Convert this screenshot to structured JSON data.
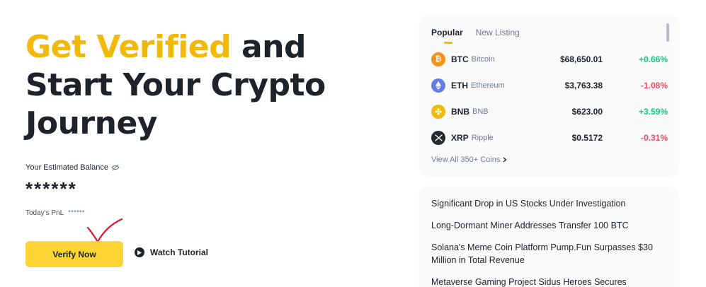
{
  "hero": {
    "title_accent": "Get Verified",
    "title_rest_1": " and",
    "title_line_2": "Start Your Crypto",
    "title_line_3": "Journey"
  },
  "balance": {
    "label": "Your Estimated Balance",
    "value": "******",
    "pnl_label": "Today's PnL",
    "pnl_value": "******"
  },
  "actions": {
    "verify_label": "Verify Now",
    "tutorial_label": "Watch Tutorial"
  },
  "market": {
    "tabs": [
      "Popular",
      "New Listing"
    ],
    "coins": [
      {
        "symbol": "BTC",
        "name": "Bitcoin",
        "price": "$68,650.01",
        "change": "+0.66%",
        "direction": "up",
        "icon": "bitcoin-icon",
        "color": "#f7931a"
      },
      {
        "symbol": "ETH",
        "name": "Ethereum",
        "price": "$3,763.38",
        "change": "-1.08%",
        "direction": "down",
        "icon": "ethereum-icon",
        "color": "#627eea"
      },
      {
        "symbol": "BNB",
        "name": "BNB",
        "price": "$623.00",
        "change": "+3.59%",
        "direction": "up",
        "icon": "bnb-icon",
        "color": "#f0b90b"
      },
      {
        "symbol": "XRP",
        "name": "Ripple",
        "price": "$0.5172",
        "change": "-0.31%",
        "direction": "down",
        "icon": "xrp-icon",
        "color": "#23292f"
      }
    ],
    "view_all": "View All 350+ Coins"
  },
  "news": [
    "Significant Drop in US Stocks Under Investigation",
    "Long-Dormant Miner Addresses Transfer 100 BTC",
    "Solana's Meme Coin Platform Pump.Fun Surpasses $30 Million in Total Revenue",
    "Metaverse Gaming Project Sidus Heroes Secures"
  ],
  "colors": {
    "accent": "#f0b90b",
    "button": "#fcd535",
    "positive": "#0ecb81",
    "negative": "#f6465d",
    "checkmark": "#e0142c"
  }
}
